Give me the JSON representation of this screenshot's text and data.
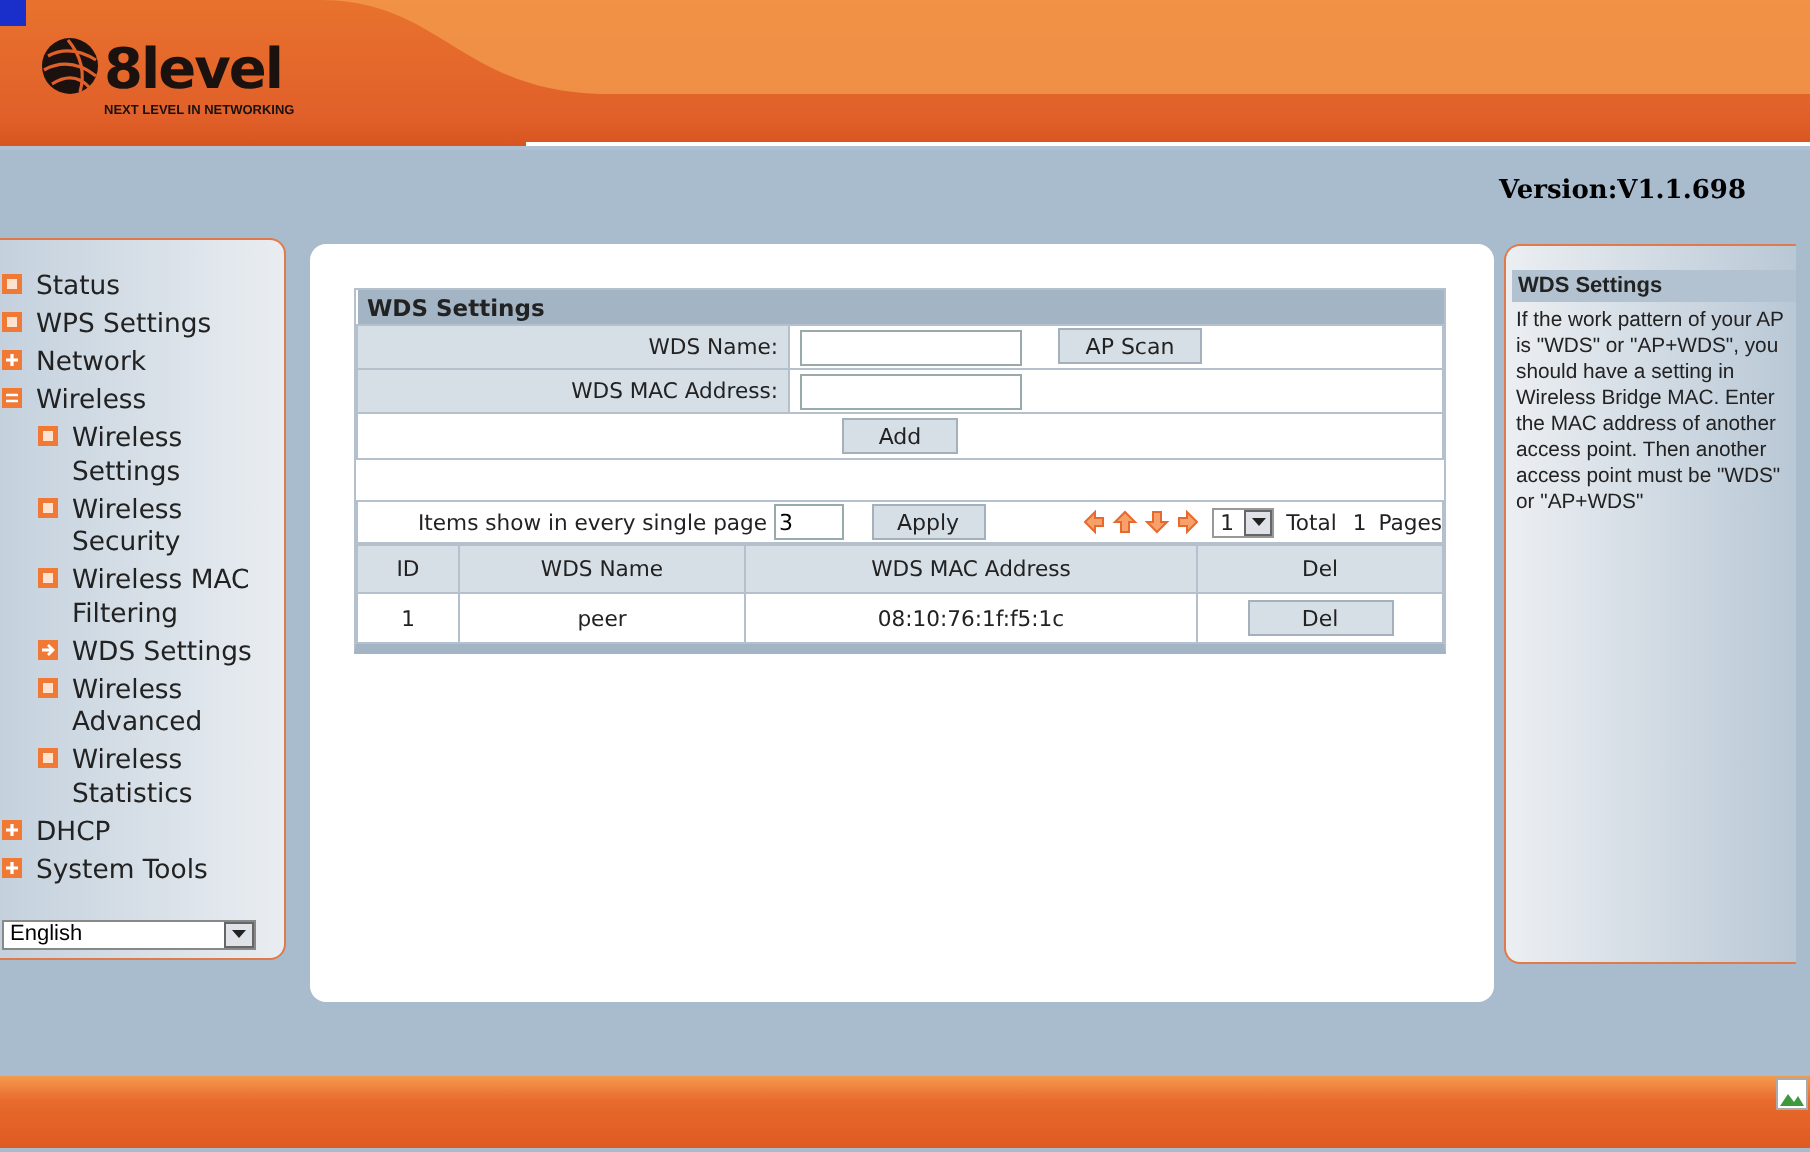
{
  "header": {
    "brand": "8level",
    "tagline": "NEXT LEVEL IN NETWORKING"
  },
  "version": "Version:V1.1.698",
  "sidebar": {
    "items": [
      {
        "label": "Status",
        "kind": "page",
        "selected": false
      },
      {
        "label": "WPS Settings",
        "kind": "page",
        "selected": false
      },
      {
        "label": "Network",
        "kind": "folder",
        "expanded": false
      },
      {
        "label": "Wireless",
        "kind": "folder",
        "expanded": true,
        "children": [
          {
            "label": "Wireless Settings",
            "kind": "page",
            "selected": false
          },
          {
            "label": "Wireless Security",
            "kind": "page",
            "selected": false
          },
          {
            "label": "Wireless MAC Filtering",
            "kind": "page",
            "selected": false
          },
          {
            "label": "WDS Settings",
            "kind": "page",
            "selected": true
          },
          {
            "label": "Wireless Advanced",
            "kind": "page",
            "selected": false
          },
          {
            "label": "Wireless Statistics",
            "kind": "page",
            "selected": false
          }
        ]
      },
      {
        "label": "DHCP",
        "kind": "folder",
        "expanded": false
      },
      {
        "label": "System Tools",
        "kind": "folder",
        "expanded": false
      }
    ],
    "language": "English"
  },
  "form": {
    "title": "WDS Settings",
    "name_label": "WDS Name:",
    "scan_button": "AP Scan",
    "mac_label": "WDS MAC Address:",
    "add_button": "Add"
  },
  "pager": {
    "items_label": "Items show in every single page",
    "items_value": "3",
    "apply_button": "Apply",
    "page_value": "1",
    "total_label": "Total",
    "total_pages": "1",
    "pages_label": "Pages"
  },
  "table": {
    "columns": [
      "ID",
      "WDS Name",
      "WDS MAC Address",
      "Del"
    ],
    "rows": [
      {
        "id": "1",
        "name": "peer",
        "mac": "08:10:76:1f:f5:1c",
        "del_button": "Del"
      }
    ]
  },
  "help": {
    "title": "WDS Settings",
    "text": "If the work pattern of your AP is \"WDS\" or \"AP+WDS\", you should have a setting in Wireless Bridge MAC. Enter the MAC address of another access point. Then another access point must be \"WDS\" or \"AP+WDS\""
  }
}
